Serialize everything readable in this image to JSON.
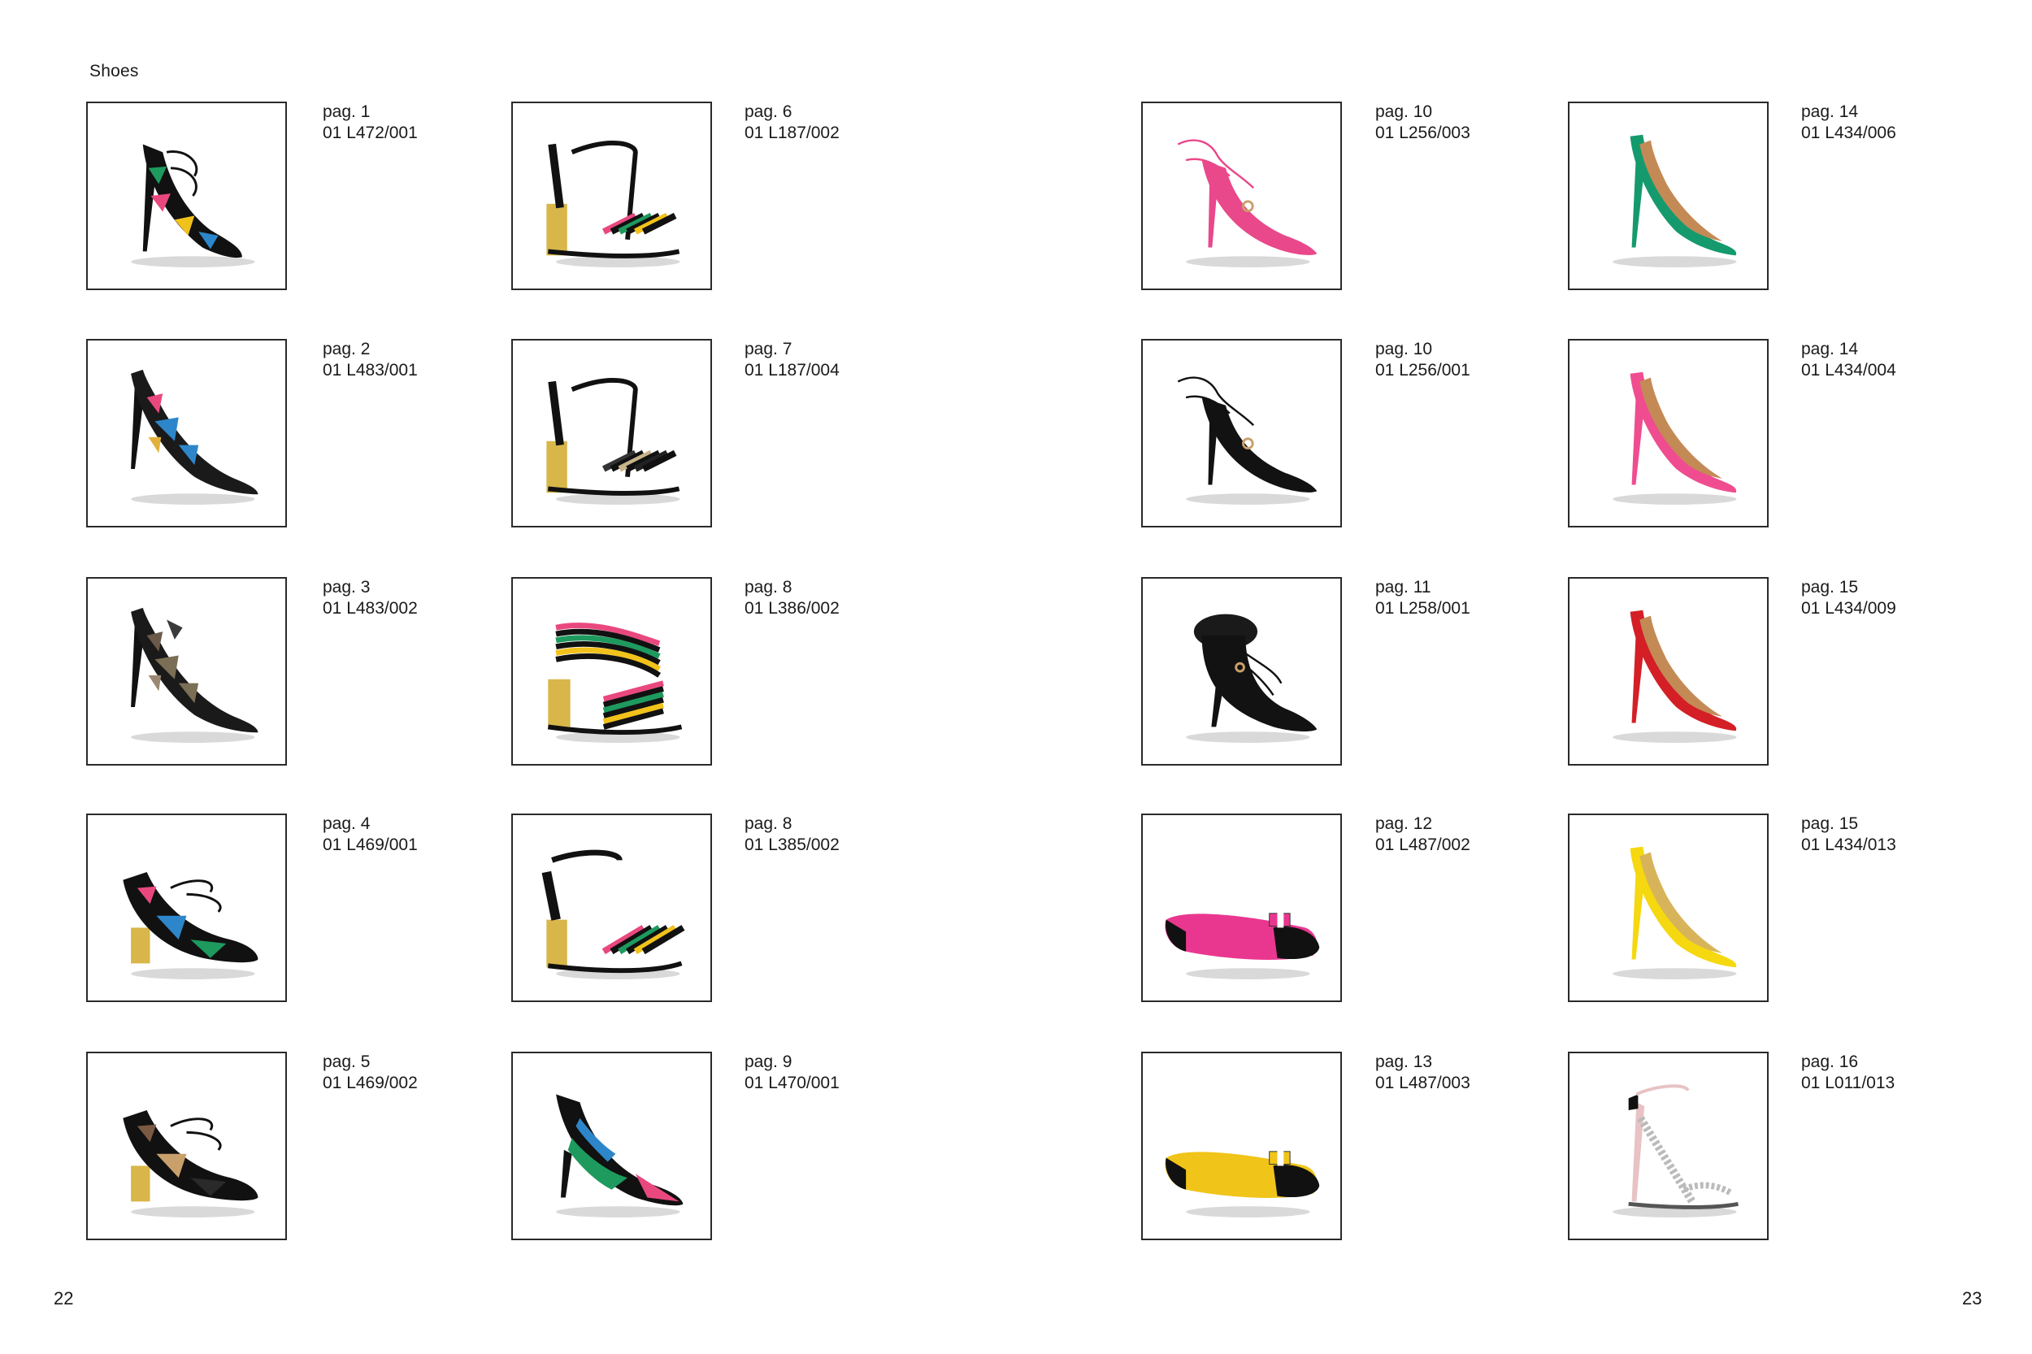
{
  "section_title": "Shoes",
  "page_numbers": {
    "left": "22",
    "right": "23"
  },
  "items": [
    {
      "page": "pag. 1",
      "code": "01 L472/001",
      "style": "lace-sandal",
      "colors": [
        "#111111",
        "#e9487f",
        "#2d86c9",
        "#f1c21b",
        "#1e9a5e"
      ]
    },
    {
      "page": "pag. 2",
      "code": "01 L483/001",
      "style": "pump-cutout",
      "colors": [
        "#1a1a1a",
        "#e9487f",
        "#2d86c9",
        "#e2b13c",
        "#ffffff"
      ]
    },
    {
      "page": "pag. 3",
      "code": "01 L483/002",
      "style": "pump-cutout",
      "colors": [
        "#1a1a1a",
        "#6b5a4a",
        "#7a6e54",
        "#9b8872",
        "#3a3a3a"
      ]
    },
    {
      "page": "pag. 4",
      "code": "01 L469/001",
      "style": "block-sandal",
      "colors": [
        "#111111",
        "#e9487f",
        "#2d86c9",
        "#1e9a5e",
        "#d8b64a"
      ]
    },
    {
      "page": "pag. 5",
      "code": "01 L469/002",
      "style": "block-sandal",
      "colors": [
        "#111111",
        "#7a5a42",
        "#c9a06b",
        "#2a2a2a",
        "#d8b64a"
      ]
    },
    {
      "page": "pag. 6",
      "code": "01 L187/002",
      "style": "tstrap-stripe",
      "colors": [
        "#111111",
        "#e9487f",
        "#1e9a5e",
        "#f1c21b",
        "#d8b64a"
      ]
    },
    {
      "page": "pag. 7",
      "code": "01 L187/004",
      "style": "tstrap-stripe",
      "colors": [
        "#111111",
        "#333333",
        "#c8b48a",
        "#222222",
        "#d8b64a"
      ]
    },
    {
      "page": "pag. 8",
      "code": "01 L386/002",
      "style": "cross-stripe",
      "colors": [
        "#111111",
        "#e9487f",
        "#1e9a5e",
        "#f1c21b",
        "#d8b64a"
      ]
    },
    {
      "page": "pag. 8",
      "code": "01 L385/002",
      "style": "ankle-stripe",
      "colors": [
        "#111111",
        "#e9487f",
        "#1e9a5e",
        "#f1c21b",
        "#d8b64a"
      ]
    },
    {
      "page": "pag. 9",
      "code": "01 L470/001",
      "style": "kitten-pump",
      "colors": [
        "#111111",
        "#1e9a5e",
        "#2d86c9",
        "#e9487f",
        "#111111"
      ]
    },
    {
      "page": "pag. 10",
      "code": "01 L256/003",
      "style": "lace-pump",
      "colors": [
        "#e9488a",
        "#e9488a",
        "#f07aa8",
        "#c9a06b",
        "#e9488a"
      ]
    },
    {
      "page": "pag. 10",
      "code": "01 L256/001",
      "style": "lace-pump",
      "colors": [
        "#121212",
        "#121212",
        "#333333",
        "#c9a06b",
        "#121212"
      ]
    },
    {
      "page": "pag. 11",
      "code": "01 L258/001",
      "style": "fur-bootie",
      "colors": [
        "#121212",
        "#121212",
        "#2a2a2a",
        "#c9a06b",
        "#121212"
      ]
    },
    {
      "page": "pag. 12",
      "code": "01 L487/002",
      "style": "ballet-flat",
      "colors": [
        "#e9378f",
        "#111111",
        "#e9378f",
        "#ffffff",
        "#111111"
      ]
    },
    {
      "page": "pag. 13",
      "code": "01 L487/003",
      "style": "ballet-flat",
      "colors": [
        "#f0c419",
        "#111111",
        "#f0c419",
        "#ffffff",
        "#111111"
      ]
    },
    {
      "page": "pag. 14",
      "code": "01 L434/006",
      "style": "stiletto-pump",
      "colors": [
        "#159a6e",
        "#159a6e",
        "#c48a56",
        "#159a6e",
        "#159a6e"
      ]
    },
    {
      "page": "pag. 14",
      "code": "01 L434/004",
      "style": "stiletto-pump",
      "colors": [
        "#ef4d8f",
        "#ef4d8f",
        "#c48a56",
        "#ef4d8f",
        "#ef4d8f"
      ]
    },
    {
      "page": "pag. 15",
      "code": "01 L434/009",
      "style": "stiletto-pump",
      "colors": [
        "#d41f26",
        "#d41f26",
        "#c48a56",
        "#d41f26",
        "#d41f26"
      ]
    },
    {
      "page": "pag. 15",
      "code": "01 L434/013",
      "style": "stiletto-pump",
      "colors": [
        "#f5d80f",
        "#f5d80f",
        "#d7b45a",
        "#f5d80f",
        "#f5d80f"
      ]
    },
    {
      "page": "pag. 16",
      "code": "01 L011/013",
      "style": "strappy-sandal",
      "colors": [
        "#e8c2c4",
        "#333333",
        "#bbbbbb",
        "#111111",
        "#e8c2c4"
      ]
    }
  ]
}
